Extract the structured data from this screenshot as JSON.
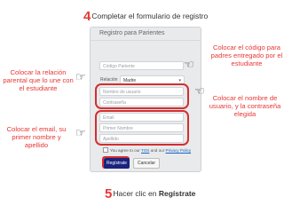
{
  "step4": {
    "number": "4",
    "text": "Completar el formulario de registro"
  },
  "step5": {
    "number": "5",
    "text": "Hacer clic en ",
    "bold": "Regístrate"
  },
  "notes": {
    "codigo": "Colocar el código para padres entregado por el estudiante",
    "relacion": "Colocar la relación parental que lo une con el estudiante",
    "usuario": "Colocar el nombre de usuario, y la contraseña elegida",
    "email": "Colocar el email, su primer nombre y apellido"
  },
  "form": {
    "title": "Registro para Parientes",
    "codigo_placeholder": "Código Pariente",
    "relacion_label": "Relación",
    "relacion_value": "Madre",
    "usuario_placeholder": "Nombre de usuario",
    "contrasena_placeholder": "Contraseña",
    "email_placeholder": "Email",
    "nombre_placeholder": "Primer Nombre",
    "apellido_placeholder": "Apellido",
    "terms_prefix": "You agree to our ",
    "terms_link": "TOS",
    "terms_mid": " and our ",
    "privacy_link": "Privacy Policy",
    "register_button": "Regístrate",
    "cancel_button": "Cancelar"
  },
  "icons": [
    "pointing-hand-icon",
    "checkbox-icon"
  ],
  "colors": {
    "accent": "#e53935",
    "button": "#1a237e"
  }
}
